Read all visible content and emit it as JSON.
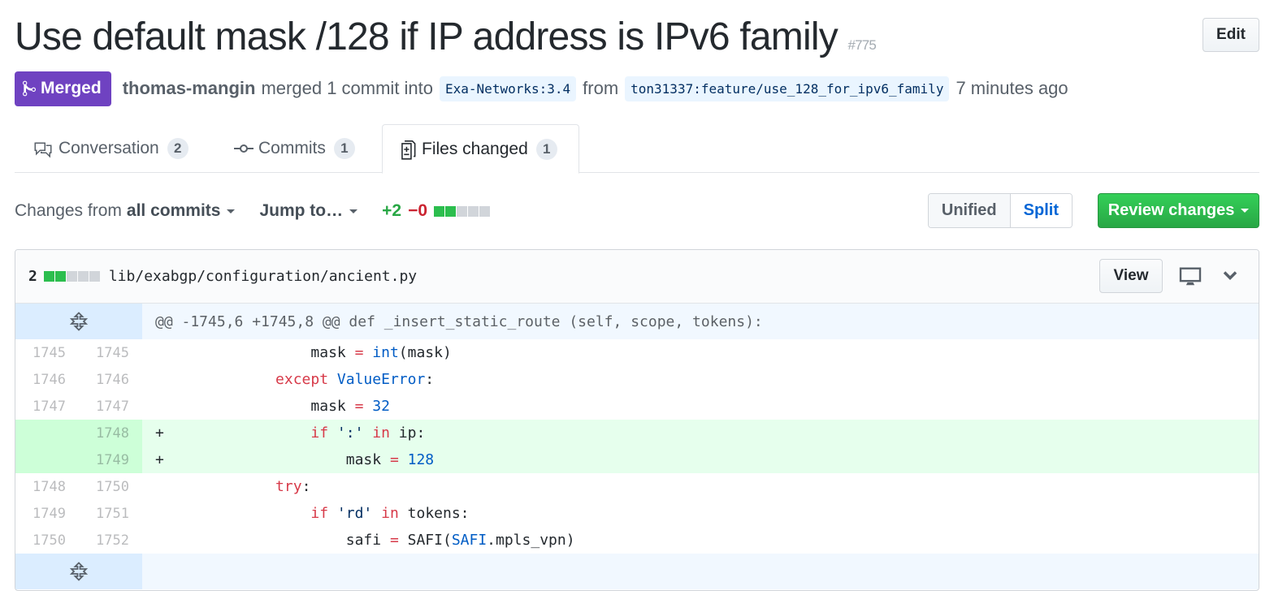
{
  "pr": {
    "title": "Use default mask /128 if IP address is IPv6 family",
    "number": "#775",
    "edit_label": "Edit",
    "state_label": "Merged",
    "state_color": "#6f42c1",
    "author": "thomas-mangin",
    "merged_text": "merged 1 commit into",
    "base_branch": "Exa-Networks:3.4",
    "from_text": "from",
    "head_branch": "ton31337:feature/use_128_for_ipv6_family",
    "time_ago": "7 minutes ago"
  },
  "tabs": [
    {
      "label": "Conversation",
      "count": "2",
      "icon": "comment-discussion-icon",
      "selected": false
    },
    {
      "label": "Commits",
      "count": "1",
      "icon": "git-commit-icon",
      "selected": false
    },
    {
      "label": "Files changed",
      "count": "1",
      "icon": "file-diff-icon",
      "selected": true
    }
  ],
  "toolbar": {
    "changes_from_prefix": "Changes from",
    "changes_from_value": "all commits",
    "jump_to": "Jump to…",
    "additions": "+2",
    "deletions": "−0",
    "diffstat_blocks": {
      "added": 2,
      "neutral": 3
    },
    "unified_label": "Unified",
    "split_label": "Split",
    "review_label": "Review changes"
  },
  "file": {
    "changes": "2",
    "diffstat_blocks": {
      "added": 2,
      "neutral": 3
    },
    "path": "lib/exabgp/configuration/ancient.py",
    "view_label": "View",
    "hunk_header": "@@ -1745,6 +1745,8 @@ def _insert_static_route (self, scope, tokens):",
    "lines": [
      {
        "old": "1745",
        "new": "1745",
        "type": "context",
        "marker": " "
      },
      {
        "old": "1746",
        "new": "1746",
        "type": "context",
        "marker": " "
      },
      {
        "old": "1747",
        "new": "1747",
        "type": "context",
        "marker": " "
      },
      {
        "old": "",
        "new": "1748",
        "type": "add",
        "marker": "+"
      },
      {
        "old": "",
        "new": "1749",
        "type": "add",
        "marker": "+"
      },
      {
        "old": "1748",
        "new": "1750",
        "type": "context",
        "marker": " "
      },
      {
        "old": "1749",
        "new": "1751",
        "type": "context",
        "marker": " "
      },
      {
        "old": "1750",
        "new": "1752",
        "type": "context",
        "marker": " "
      }
    ],
    "code": {
      "l0": {
        "indent": "                ",
        "a": "mask ",
        "op": "=",
        "sp": " ",
        "fn": "int",
        "rest": "(mask)"
      },
      "l1": {
        "indent": "            ",
        "kw": "except",
        "sp": " ",
        "cls": "ValueError",
        "rest": ":"
      },
      "l2": {
        "indent": "                ",
        "a": "mask ",
        "op": "=",
        "sp": " ",
        "val": "32"
      },
      "l3": {
        "indent": "                ",
        "kw": "if",
        "sp": " ",
        "str": "':'",
        "sp2": " ",
        "kw2": "in",
        "rest": " ip:"
      },
      "l4": {
        "indent": "                    ",
        "a": "mask ",
        "op": "=",
        "sp": " ",
        "val": "128"
      },
      "l5": {
        "indent": "            ",
        "kw": "try",
        "rest": ":"
      },
      "l6": {
        "indent": "                ",
        "kw": "if",
        "sp": " ",
        "str": "'rd'",
        "sp2": " ",
        "kw2": "in",
        "rest": " tokens:"
      },
      "l7": {
        "indent": "                    ",
        "a": "safi ",
        "op": "=",
        "mid": " SAFI(",
        "cls": "SAFI",
        "rest": ".mpls_vpn)"
      }
    }
  }
}
